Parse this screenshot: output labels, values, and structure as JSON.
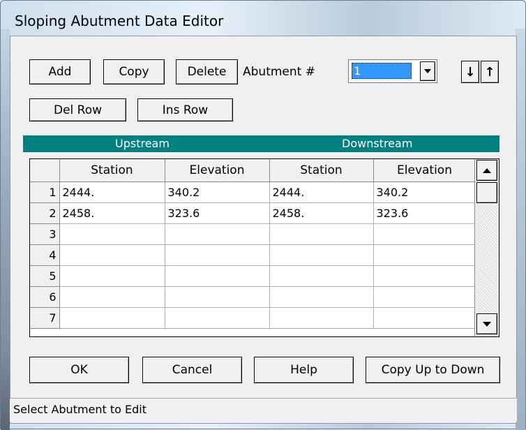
{
  "window": {
    "title": "Sloping Abutment Data Editor"
  },
  "toolbar": {
    "add": "Add",
    "copy": "Copy",
    "delete": "Delete",
    "abutment_label": "Abutment #",
    "abutment_value": "1",
    "move_down": "↓",
    "move_up": "↑",
    "del_row": "Del Row",
    "ins_row": "Ins Row"
  },
  "groups": {
    "upstream": "Upstream",
    "downstream": "Downstream"
  },
  "table": {
    "columns": [
      "Station",
      "Elevation",
      "Station",
      "Elevation"
    ],
    "rows": [
      {
        "num": "1",
        "cells": [
          "2444.",
          "340.2",
          "2444.",
          "340.2"
        ]
      },
      {
        "num": "2",
        "cells": [
          "2458.",
          "323.6",
          "2458.",
          "323.6"
        ]
      },
      {
        "num": "3",
        "cells": [
          "",
          "",
          "",
          ""
        ]
      },
      {
        "num": "4",
        "cells": [
          "",
          "",
          "",
          ""
        ]
      },
      {
        "num": "5",
        "cells": [
          "",
          "",
          "",
          ""
        ]
      },
      {
        "num": "6",
        "cells": [
          "",
          "",
          "",
          ""
        ]
      },
      {
        "num": "7",
        "cells": [
          "",
          "",
          "",
          ""
        ]
      }
    ]
  },
  "buttons": {
    "ok": "OK",
    "cancel": "Cancel",
    "help": "Help",
    "copy_up_to_down": "Copy Up to Down"
  },
  "status": "Select Abutment to Edit",
  "colors": {
    "header_band": "#008080",
    "selection": "#3399ff"
  }
}
